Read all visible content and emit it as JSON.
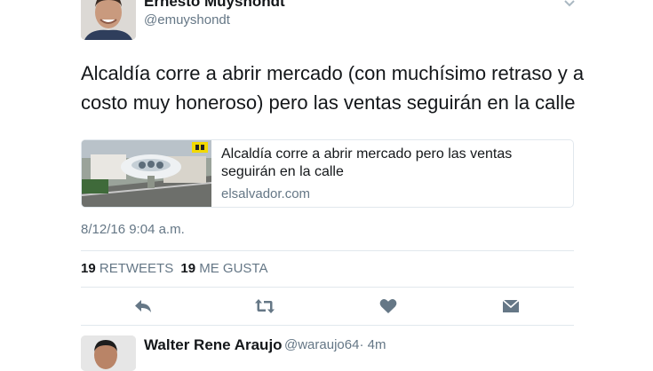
{
  "tweet": {
    "author_name": "Ernesto Muyshondt",
    "author_handle": "@emuyshondt",
    "text": "Alcaldía corre a abrir mercado (con muchísimo retraso y a costo muy honeroso) pero las ventas seguirán en la calle",
    "card": {
      "title": "Alcaldía corre a abrir mercado pero las ventas seguirán en la calle",
      "domain": "elsalvador.com"
    },
    "timestamp": "8/12/16 9:04 a.m.",
    "stats": {
      "retweets_count": "19",
      "retweets_label": "RETWEETS",
      "likes_count": "19",
      "likes_label": "ME GUSTA"
    }
  },
  "actions": [
    {
      "name": "reply-icon"
    },
    {
      "name": "retweet-icon"
    },
    {
      "name": "like-icon"
    },
    {
      "name": "direct-message-icon"
    }
  ],
  "reply": {
    "author_name": "Walter Rene Araujo",
    "author_handle": "@waraujo64",
    "time": "· 4m"
  },
  "colors": {
    "text": "#14171a",
    "muted": "#657786",
    "divider": "#e1e8ed",
    "icon": "#657786"
  }
}
